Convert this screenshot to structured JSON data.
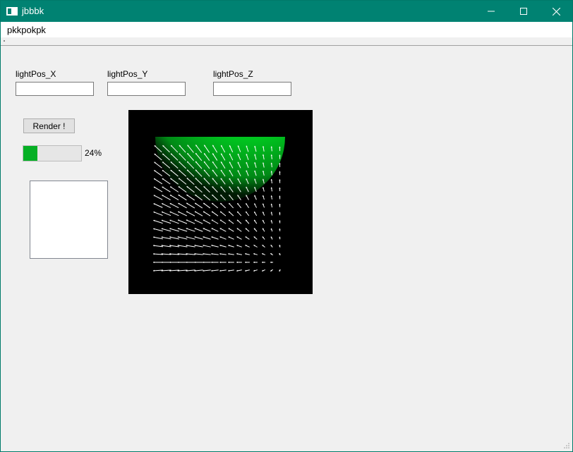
{
  "window": {
    "title": "jbbbk"
  },
  "menu": {
    "items": [
      "pkkpokpk"
    ]
  },
  "form": {
    "light_x_label": "lightPos_X",
    "light_y_label": "lightPos_Y",
    "light_z_label": "lightPos_Z",
    "light_x_value": "",
    "light_y_value": "",
    "light_z_value": ""
  },
  "render": {
    "button_label": "Render !"
  },
  "progress": {
    "value": 0.24,
    "text": "24%"
  },
  "colors": {
    "titlebar": "#008272",
    "progress_fill": "#06b025",
    "sphere": "#00c820",
    "arrows": "#ffffff",
    "background": "#000000"
  },
  "icons": {
    "app": "app-window-icon",
    "minimize": "minimize-icon",
    "maximize": "maximize-icon",
    "close": "close-icon"
  }
}
